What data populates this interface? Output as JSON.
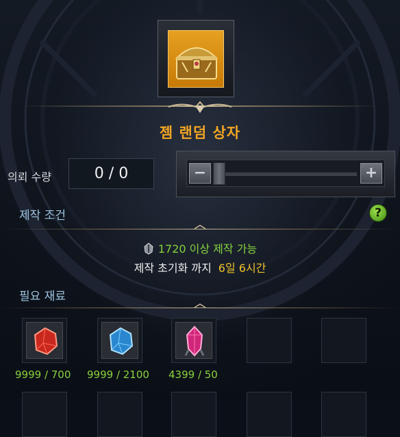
{
  "item": {
    "name": "젬 랜덤 상자",
    "icon": "treasure-chest-icon"
  },
  "quantity": {
    "label": "의뢰 수량",
    "value": "0 / 0",
    "minus": "−",
    "plus": "+"
  },
  "conditions": {
    "title": "제작 조건",
    "help": "?",
    "level_value": "1720",
    "level_text": " 이상 제작 가능",
    "reset_label": "제작 초기화 까지",
    "reset_time": "6일 6시간"
  },
  "materials": {
    "title": "필요 재료",
    "items": [
      {
        "icon": "red-gem-icon",
        "count": "9999 / 700"
      },
      {
        "icon": "blue-gem-icon",
        "count": "9999 / 2100"
      },
      {
        "icon": "pink-gem-icon",
        "count": "4399 / 50"
      }
    ]
  },
  "colors": {
    "title": "#f2a623",
    "green": "#86d23e",
    "time": "#f0c22b",
    "section": "#9dc4e0"
  }
}
